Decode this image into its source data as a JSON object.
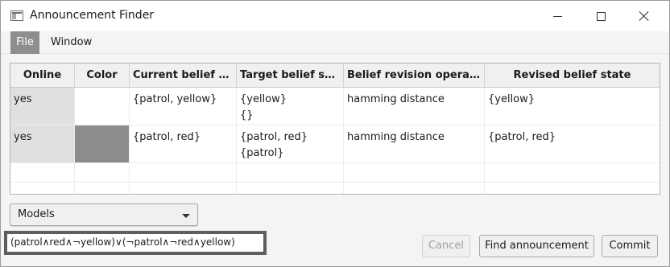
{
  "window": {
    "title": "Announcement Finder"
  },
  "menu": {
    "file": "File",
    "window": "Window"
  },
  "table": {
    "columns": [
      "Online",
      "Color",
      "Current belief st...",
      "Target belief state",
      "Belief revision operator",
      "Revised belief state"
    ],
    "rows": [
      {
        "online": "yes",
        "color": "#ffffff",
        "current": "{patrol, yellow}",
        "target_line1": "{yellow}",
        "target_line2": "{}",
        "operator": "hamming distance",
        "revised": "{yellow}"
      },
      {
        "online": "yes",
        "color": "#8c8c8c",
        "current": "{patrol, red}",
        "target_line1": "{patrol, red}",
        "target_line2": "{patrol}",
        "operator": "hamming distance",
        "revised": "{patrol, red}"
      }
    ]
  },
  "models": {
    "label": "Models"
  },
  "formula": {
    "text": "(patrol∧red∧¬yellow)∨(¬patrol∧¬red∧yellow)"
  },
  "buttons": {
    "cancel": "Cancel",
    "find": "Find announcement",
    "commit": "Commit"
  },
  "icons": {
    "app": "window-app-icon",
    "minimize": "minimize-icon",
    "maximize": "maximize-icon",
    "close": "close-icon",
    "dropdown": "chevron-down-icon"
  }
}
